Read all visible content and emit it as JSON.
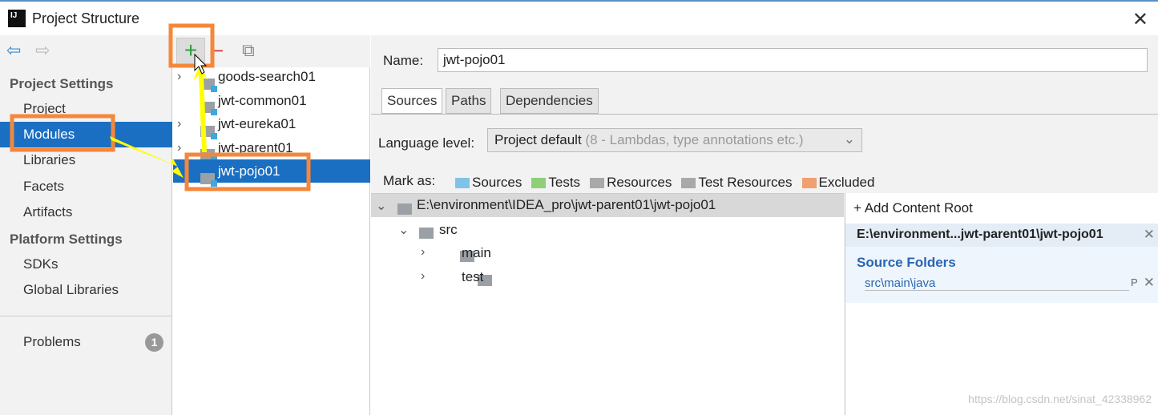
{
  "window": {
    "title": "Project Structure",
    "logo": "IJ",
    "close": "✕"
  },
  "sidebar": {
    "back": "⇦",
    "forward": "⇨",
    "project_settings": "Project Settings",
    "items": [
      "Project",
      "Modules",
      "Libraries",
      "Facets",
      "Artifacts"
    ],
    "platform_settings": "Platform Settings",
    "platform_items": [
      "SDKs",
      "Global Libraries"
    ],
    "problems": "Problems",
    "problems_count": "1"
  },
  "modules": {
    "add": "+",
    "remove": "−",
    "copy": "⧉",
    "list": [
      {
        "name": "goods-search01",
        "expandable": true
      },
      {
        "name": "jwt-common01",
        "expandable": false
      },
      {
        "name": "jwt-eureka01",
        "expandable": true
      },
      {
        "name": "jwt-parent01",
        "expandable": true
      },
      {
        "name": "jwt-pojo01",
        "expandable": false,
        "selected": true
      }
    ]
  },
  "main": {
    "name_label": "Name:",
    "name_value": "jwt-pojo01",
    "tabs": [
      "Sources",
      "Paths",
      "Dependencies"
    ],
    "active_tab": "Sources",
    "language_label": "Language level:",
    "language_value": "Project default",
    "language_hint": "(8 - Lambdas, type annotations etc.)",
    "mark_as": "Mark as:",
    "marks": [
      {
        "label": "Sources",
        "color": "#7fc4e8"
      },
      {
        "label": "Tests",
        "color": "#8fcf7a"
      },
      {
        "label": "Resources",
        "color": "#a9a9a9"
      },
      {
        "label": "Test Resources",
        "color": "#a9a9a9"
      },
      {
        "label": "Excluded",
        "color": "#f0a070"
      }
    ],
    "tree": {
      "root": "E:\\environment\\IDEA_pro\\jwt-parent01\\jwt-pojo01",
      "src": "src",
      "main": "main",
      "test": "test"
    },
    "content_root": {
      "add": "+ Add Content Root",
      "path": "E:\\environment...jwt-parent01\\jwt-pojo01",
      "source_folders": "Source Folders",
      "folder": "src\\main\\java",
      "folder_action": "P",
      "remove": "✕"
    }
  },
  "watermark": "https://blog.csdn.net/sinat_42338962",
  "colors": {
    "selection": "#1a6fc2",
    "annotation_box": "#f5873a",
    "annotation_arrow": "#ffff00"
  }
}
